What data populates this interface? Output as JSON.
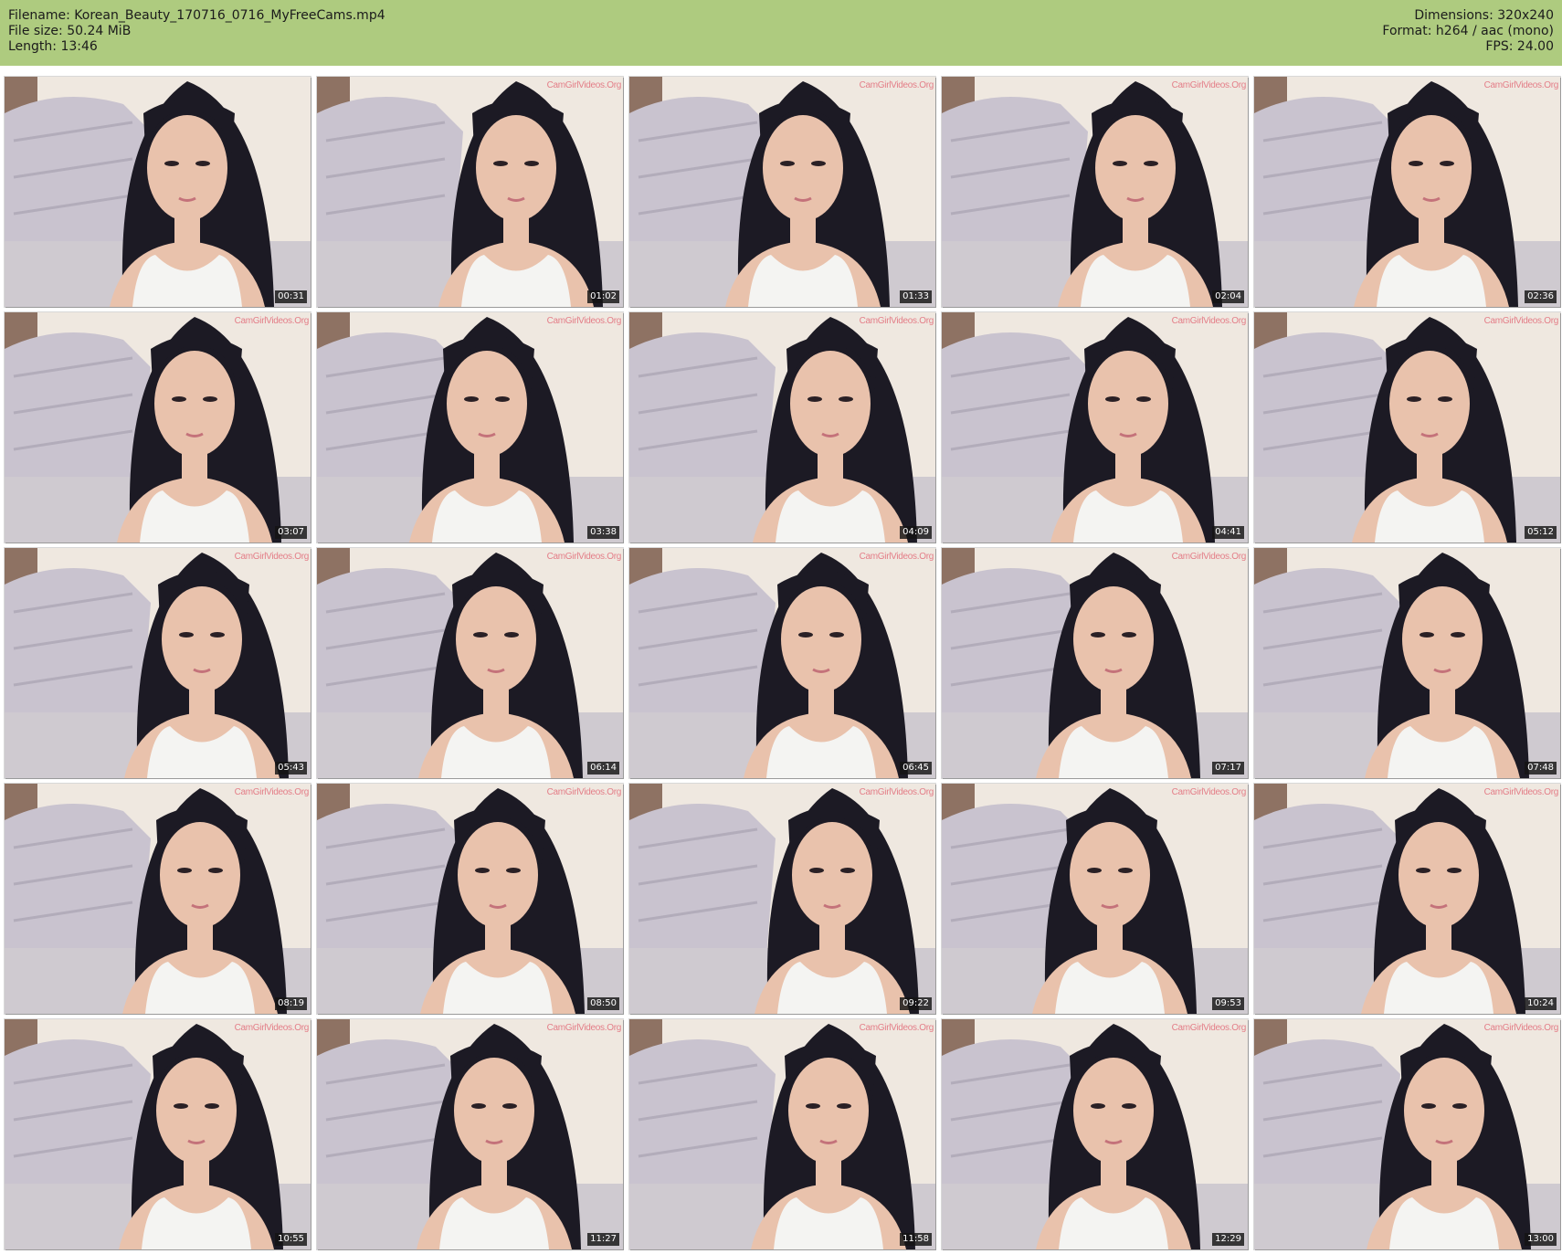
{
  "header": {
    "filename": "Filename: Korean_Beauty_170716_0716_MyFreeCams.mp4",
    "filesize": "File size: 50.24 MiB",
    "length": "Length: 13:46",
    "dimensions": "Dimensions: 320x240",
    "format": "Format: h264 / aac (mono)",
    "fps": "FPS: 24.00"
  },
  "colors": {
    "header_bg": "#aecb7f",
    "wall": "#efe8e0",
    "couch": "#c9c3cf",
    "hair": "#1c1a24",
    "skin": "#e9c2ac",
    "top": "#f4f4f2"
  },
  "watermark": "CamGirlVideos.Org",
  "frames": [
    {
      "time": "00:31"
    },
    {
      "time": "01:02"
    },
    {
      "time": "01:33"
    },
    {
      "time": "02:04"
    },
    {
      "time": "02:36"
    },
    {
      "time": "03:07"
    },
    {
      "time": "03:38"
    },
    {
      "time": "04:09"
    },
    {
      "time": "04:41"
    },
    {
      "time": "05:12"
    },
    {
      "time": "05:43"
    },
    {
      "time": "06:14"
    },
    {
      "time": "06:45"
    },
    {
      "time": "07:17"
    },
    {
      "time": "07:48"
    },
    {
      "time": "08:19"
    },
    {
      "time": "08:50"
    },
    {
      "time": "09:22"
    },
    {
      "time": "09:53"
    },
    {
      "time": "10:24"
    },
    {
      "time": "10:55"
    },
    {
      "time": "11:27"
    },
    {
      "time": "11:58"
    },
    {
      "time": "12:29"
    },
    {
      "time": "13:00"
    }
  ]
}
